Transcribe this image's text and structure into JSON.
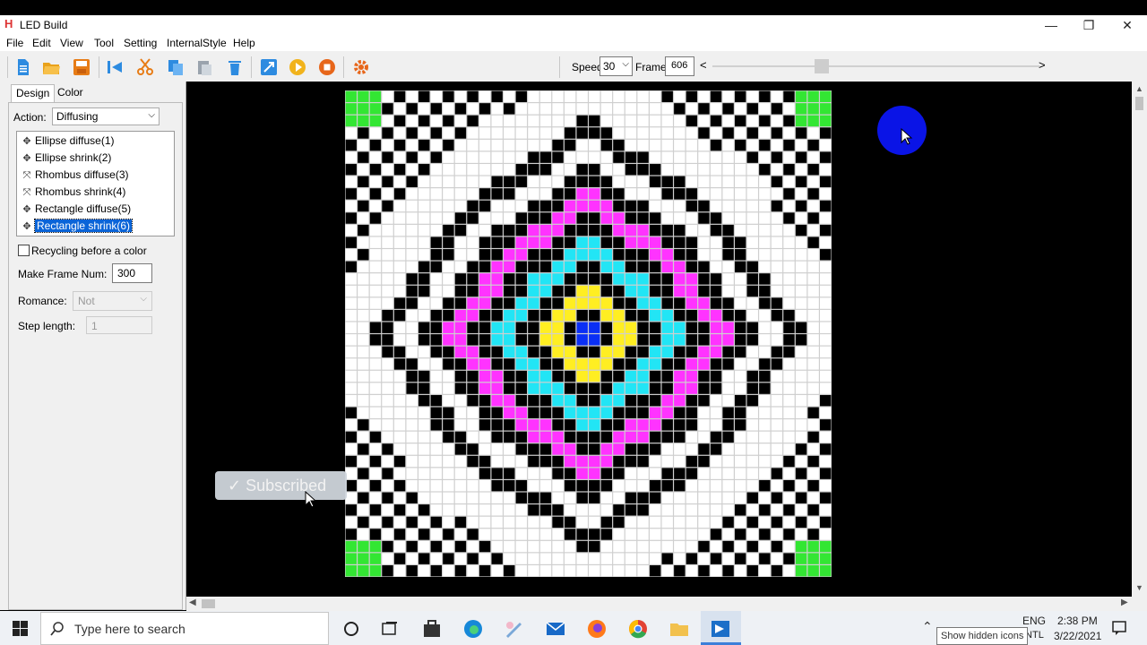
{
  "window": {
    "title": "LED Build",
    "min": "—",
    "restore": "❐",
    "close": "✕"
  },
  "menu": [
    "File",
    "Edit",
    "View",
    "Tool",
    "Setting",
    "InternalStyle",
    "Help"
  ],
  "toolbar": {
    "speed_label": "Speed:",
    "speed_value": "30",
    "frame_label": "Frame:",
    "frame_value": "606"
  },
  "tabs": {
    "design": "Design",
    "color": "Color"
  },
  "panel": {
    "action_label": "Action:",
    "action_value": "Diffusing",
    "effects": [
      {
        "label": "Ellipse diffuse(1)",
        "icon": "diffuse-icon"
      },
      {
        "label": "Ellipse shrink(2)",
        "icon": "shrink-icon"
      },
      {
        "label": "Rhombus diffuse(3)",
        "icon": "diffuse-icon"
      },
      {
        "label": "Rhombus shrink(4)",
        "icon": "shrink-icon"
      },
      {
        "label": "Rectangle diffuse(5)",
        "icon": "diffuse-icon"
      },
      {
        "label": "Rectangle shrink(6)",
        "icon": "shrink-icon"
      }
    ],
    "selected_effect": 5,
    "recycling_label": "Recycling before a color",
    "recycling_checked": false,
    "make_frame_label": "Make Frame Num:",
    "make_frame_value": "300",
    "romance_label": "Romance:",
    "romance_value": "Not",
    "step_label": "Step length:",
    "step_value": "1"
  },
  "overlay": {
    "subscribed": "Subscribed"
  },
  "led_colors": {
    "white": "#ffffff",
    "black": "#000000",
    "green": "#33e633",
    "magenta": "#ff33ff",
    "cyan": "#22e5f5",
    "blue": "#0a2ff5",
    "yellow": "#ffee22"
  },
  "taskbar": {
    "search_placeholder": "Type here to search",
    "lang_top": "ENG",
    "lang_bottom": "INTL",
    "time": "2:38 PM",
    "date": "3/22/2021",
    "tooltip": "Show hidden icons"
  }
}
